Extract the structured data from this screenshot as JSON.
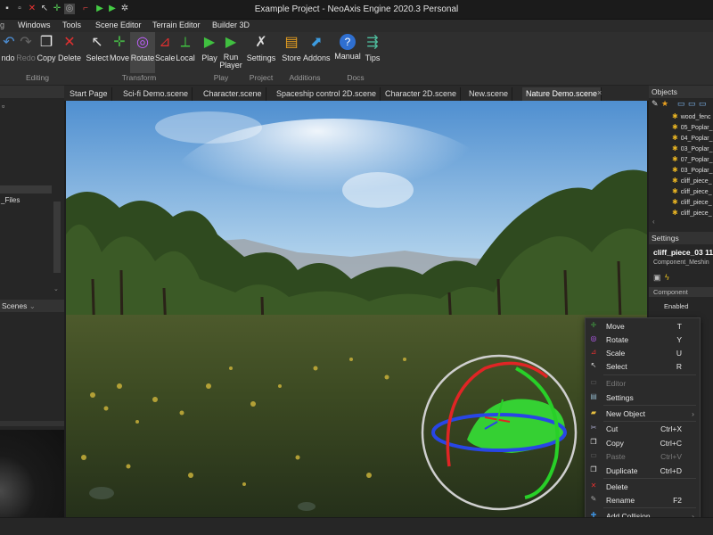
{
  "window": {
    "title": "Example Project - NeoAxis Engine 2020.3 Personal"
  },
  "menu": [
    "Windows",
    "Tools",
    "Scene Editor",
    "Terrain Editor",
    "Builder 3D"
  ],
  "ribbon": {
    "buttons": [
      "ndo",
      "Redo",
      "Copy",
      "Delete",
      "Select",
      "Move",
      "Rotate",
      "Scale",
      "Local",
      "Play",
      "Run\nPlayer",
      "Settings",
      "Store",
      "Addons",
      "Manual",
      "Tips"
    ],
    "groups": [
      "Editing",
      "Transform",
      "Play",
      "Project",
      "Additions",
      "Docs"
    ]
  },
  "tabs": [
    "Start Page",
    "Sci-fi Demo.scene",
    "Character.scene",
    "Spaceship control 2D.scene",
    "Character 2D.scene",
    "New.scene",
    "Nature Demo.scene"
  ],
  "left": {
    "files_label": "_Files",
    "scenes_label": "Scenes"
  },
  "objects": {
    "title": "Objects",
    "items": [
      "wood_fenc",
      "05_Poplar_",
      "04_Poplar_",
      "03_Poplar_",
      "07_Poplar_",
      "03_Poplar_",
      "cliff_piece_",
      "cliff_piece_",
      "cliff_piece_",
      "cliff_piece_"
    ]
  },
  "settings": {
    "title": "Settings",
    "object_name": "cliff_piece_03 11",
    "type": "Component_Meshin",
    "section": "Component",
    "enabled": "Enabled"
  },
  "context_menu": [
    {
      "label": "Move",
      "shortcut": "T"
    },
    {
      "label": "Rotate",
      "shortcut": "Y"
    },
    {
      "label": "Scale",
      "shortcut": "U"
    },
    {
      "label": "Select",
      "shortcut": "R"
    },
    {
      "label": "Editor",
      "shortcut": ""
    },
    {
      "label": "Settings",
      "shortcut": ""
    },
    {
      "label": "New Object",
      "shortcut": ""
    },
    {
      "label": "Cut",
      "shortcut": "Ctrl+X"
    },
    {
      "label": "Copy",
      "shortcut": "Ctrl+C"
    },
    {
      "label": "Paste",
      "shortcut": "Ctrl+V"
    },
    {
      "label": "Duplicate",
      "shortcut": "Ctrl+D"
    },
    {
      "label": "Delete",
      "shortcut": ""
    },
    {
      "label": "Rename",
      "shortcut": "F2"
    },
    {
      "label": "Add Collision",
      "shortcut": ""
    }
  ],
  "colors": {
    "accent": "#3d8fd9",
    "gizmo_x": "#e02020",
    "gizmo_y": "#20c020",
    "gizmo_z": "#2040e0",
    "selection": "#38e838"
  }
}
